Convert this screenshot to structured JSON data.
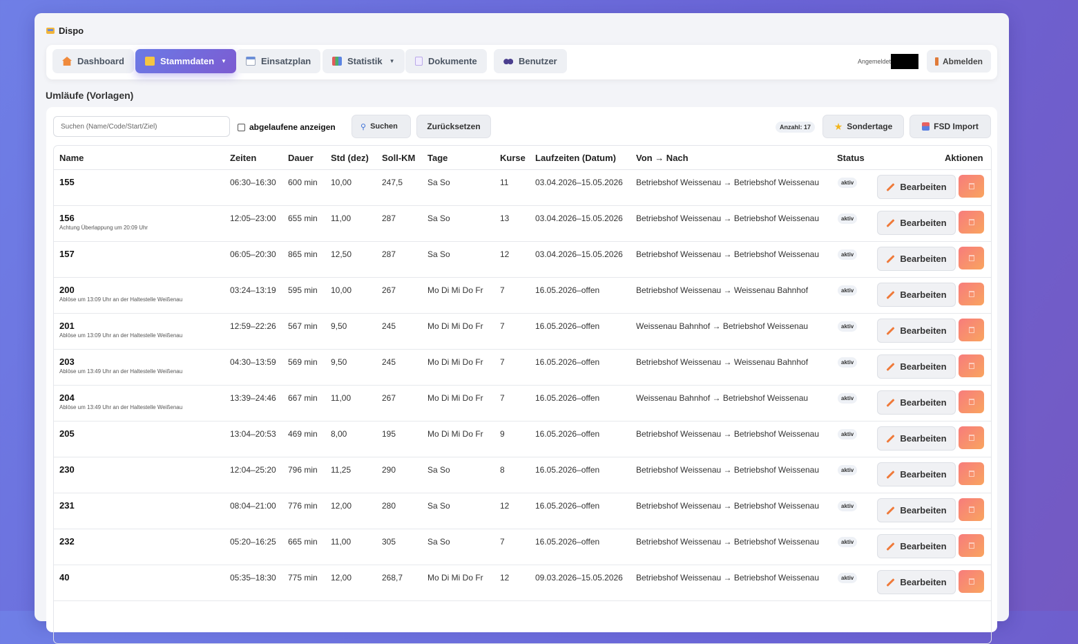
{
  "app": {
    "title": "Dispo"
  },
  "nav": {
    "items": [
      {
        "label": "Dashboard",
        "icon": "house-icon",
        "active": false
      },
      {
        "label": "Stammdaten",
        "icon": "folder-icon",
        "active": true,
        "dropdown": true
      },
      {
        "label": "Einsatzplan",
        "icon": "calendar-icon",
        "active": false
      },
      {
        "label": "Statistik",
        "icon": "bar-chart-icon",
        "active": false,
        "dropdown": true
      },
      {
        "label": "Dokumente",
        "icon": "document-icon",
        "active": false
      },
      {
        "label": "Benutzer",
        "icon": "users-icon",
        "active": false
      }
    ],
    "logged_in_label": "Angemeldet",
    "logout_label": "Abmelden"
  },
  "page": {
    "title": "Umläufe (Vorlagen)"
  },
  "toolbar": {
    "search_placeholder": "Suchen (Name/Code/Start/Ziel)",
    "search_value": "",
    "show_expired_label": "abgelaufene anzeigen",
    "show_expired_checked": false,
    "search_button": "Suchen",
    "reset_button": "Zurücksetzen",
    "count_label": "Anzahl: 17",
    "special_days_button": "Sondertage",
    "fsd_import_button": "FSD Import"
  },
  "table": {
    "headers": [
      "Name",
      "Zeiten",
      "Dauer",
      "Std (dez)",
      "Soll-KM",
      "Tage",
      "Kurse",
      "Laufzeiten (Datum)",
      "Von → Nach",
      "Status",
      "Aktionen"
    ],
    "edit_label": "Bearbeiten",
    "rows": [
      {
        "name": "155",
        "note": "",
        "zeiten": "06:30–16:30",
        "dauer": "600 min",
        "std": "10,00",
        "km": "247,5",
        "tage": "Sa So",
        "kurse": "11",
        "laufzeit": "03.04.2026–15.05.2026",
        "route": "Betriebshof Weissenau → Betriebshof Weissenau",
        "status": "aktiv"
      },
      {
        "name": "156",
        "note": "Achtung Überlappung um 20:09 Uhr",
        "zeiten": "12:05–23:00",
        "dauer": "655 min",
        "std": "11,00",
        "km": "287",
        "tage": "Sa So",
        "kurse": "13",
        "laufzeit": "03.04.2026–15.05.2026",
        "route": "Betriebshof Weissenau → Betriebshof Weissenau",
        "status": "aktiv"
      },
      {
        "name": "157",
        "note": "",
        "zeiten": "06:05–20:30",
        "dauer": "865 min",
        "std": "12,50",
        "km": "287",
        "tage": "Sa So",
        "kurse": "12",
        "laufzeit": "03.04.2026–15.05.2026",
        "route": "Betriebshof Weissenau → Betriebshof Weissenau",
        "status": "aktiv"
      },
      {
        "name": "200",
        "note": "Ablöse um 13:09 Uhr an der Haltestelle Weißenau",
        "zeiten": "03:24–13:19",
        "dauer": "595 min",
        "std": "10,00",
        "km": "267",
        "tage": "Mo Di Mi Do Fr",
        "kurse": "7",
        "laufzeit": "16.05.2026–offen",
        "route": "Betriebshof Weissenau → Weissenau Bahnhof",
        "status": "aktiv"
      },
      {
        "name": "201",
        "note": "Ablöse um 13:09 Uhr an der Haltestelle Weißenau",
        "zeiten": "12:59–22:26",
        "dauer": "567 min",
        "std": "9,50",
        "km": "245",
        "tage": "Mo Di Mi Do Fr",
        "kurse": "7",
        "laufzeit": "16.05.2026–offen",
        "route": "Weissenau Bahnhof → Betriebshof Weissenau",
        "status": "aktiv"
      },
      {
        "name": "203",
        "note": "Ablöse um 13:49 Uhr an der Haltestelle Weißenau",
        "zeiten": "04:30–13:59",
        "dauer": "569 min",
        "std": "9,50",
        "km": "245",
        "tage": "Mo Di Mi Do Fr",
        "kurse": "7",
        "laufzeit": "16.05.2026–offen",
        "route": "Betriebshof Weissenau → Weissenau Bahnhof",
        "status": "aktiv"
      },
      {
        "name": "204",
        "note": "Ablöse um 13:49 Uhr an der Haltestelle Weißenau",
        "zeiten": "13:39–24:46",
        "dauer": "667 min",
        "std": "11,00",
        "km": "267",
        "tage": "Mo Di Mi Do Fr",
        "kurse": "7",
        "laufzeit": "16.05.2026–offen",
        "route": "Weissenau Bahnhof → Betriebshof Weissenau",
        "status": "aktiv"
      },
      {
        "name": "205",
        "note": "",
        "zeiten": "13:04–20:53",
        "dauer": "469 min",
        "std": "8,00",
        "km": "195",
        "tage": "Mo Di Mi Do Fr",
        "kurse": "9",
        "laufzeit": "16.05.2026–offen",
        "route": "Betriebshof Weissenau → Betriebshof Weissenau",
        "status": "aktiv"
      },
      {
        "name": "230",
        "note": "",
        "zeiten": "12:04–25:20",
        "dauer": "796 min",
        "std": "11,25",
        "km": "290",
        "tage": "Sa So",
        "kurse": "8",
        "laufzeit": "16.05.2026–offen",
        "route": "Betriebshof Weissenau → Betriebshof Weissenau",
        "status": "aktiv"
      },
      {
        "name": "231",
        "note": "",
        "zeiten": "08:04–21:00",
        "dauer": "776 min",
        "std": "12,00",
        "km": "280",
        "tage": "Sa So",
        "kurse": "12",
        "laufzeit": "16.05.2026–offen",
        "route": "Betriebshof Weissenau → Betriebshof Weissenau",
        "status": "aktiv"
      },
      {
        "name": "232",
        "note": "",
        "zeiten": "05:20–16:25",
        "dauer": "665 min",
        "std": "11,00",
        "km": "305",
        "tage": "Sa So",
        "kurse": "7",
        "laufzeit": "16.05.2026–offen",
        "route": "Betriebshof Weissenau → Betriebshof Weissenau",
        "status": "aktiv"
      },
      {
        "name": "40",
        "note": "",
        "zeiten": "05:35–18:30",
        "dauer": "775 min",
        "std": "12,00",
        "km": "268,7",
        "tage": "Mo Di Mi Do Fr",
        "kurse": "12",
        "laufzeit": "09.03.2026–15.05.2026",
        "route": "Betriebshof Weissenau → Betriebshof Weissenau",
        "status": "aktiv"
      }
    ]
  }
}
